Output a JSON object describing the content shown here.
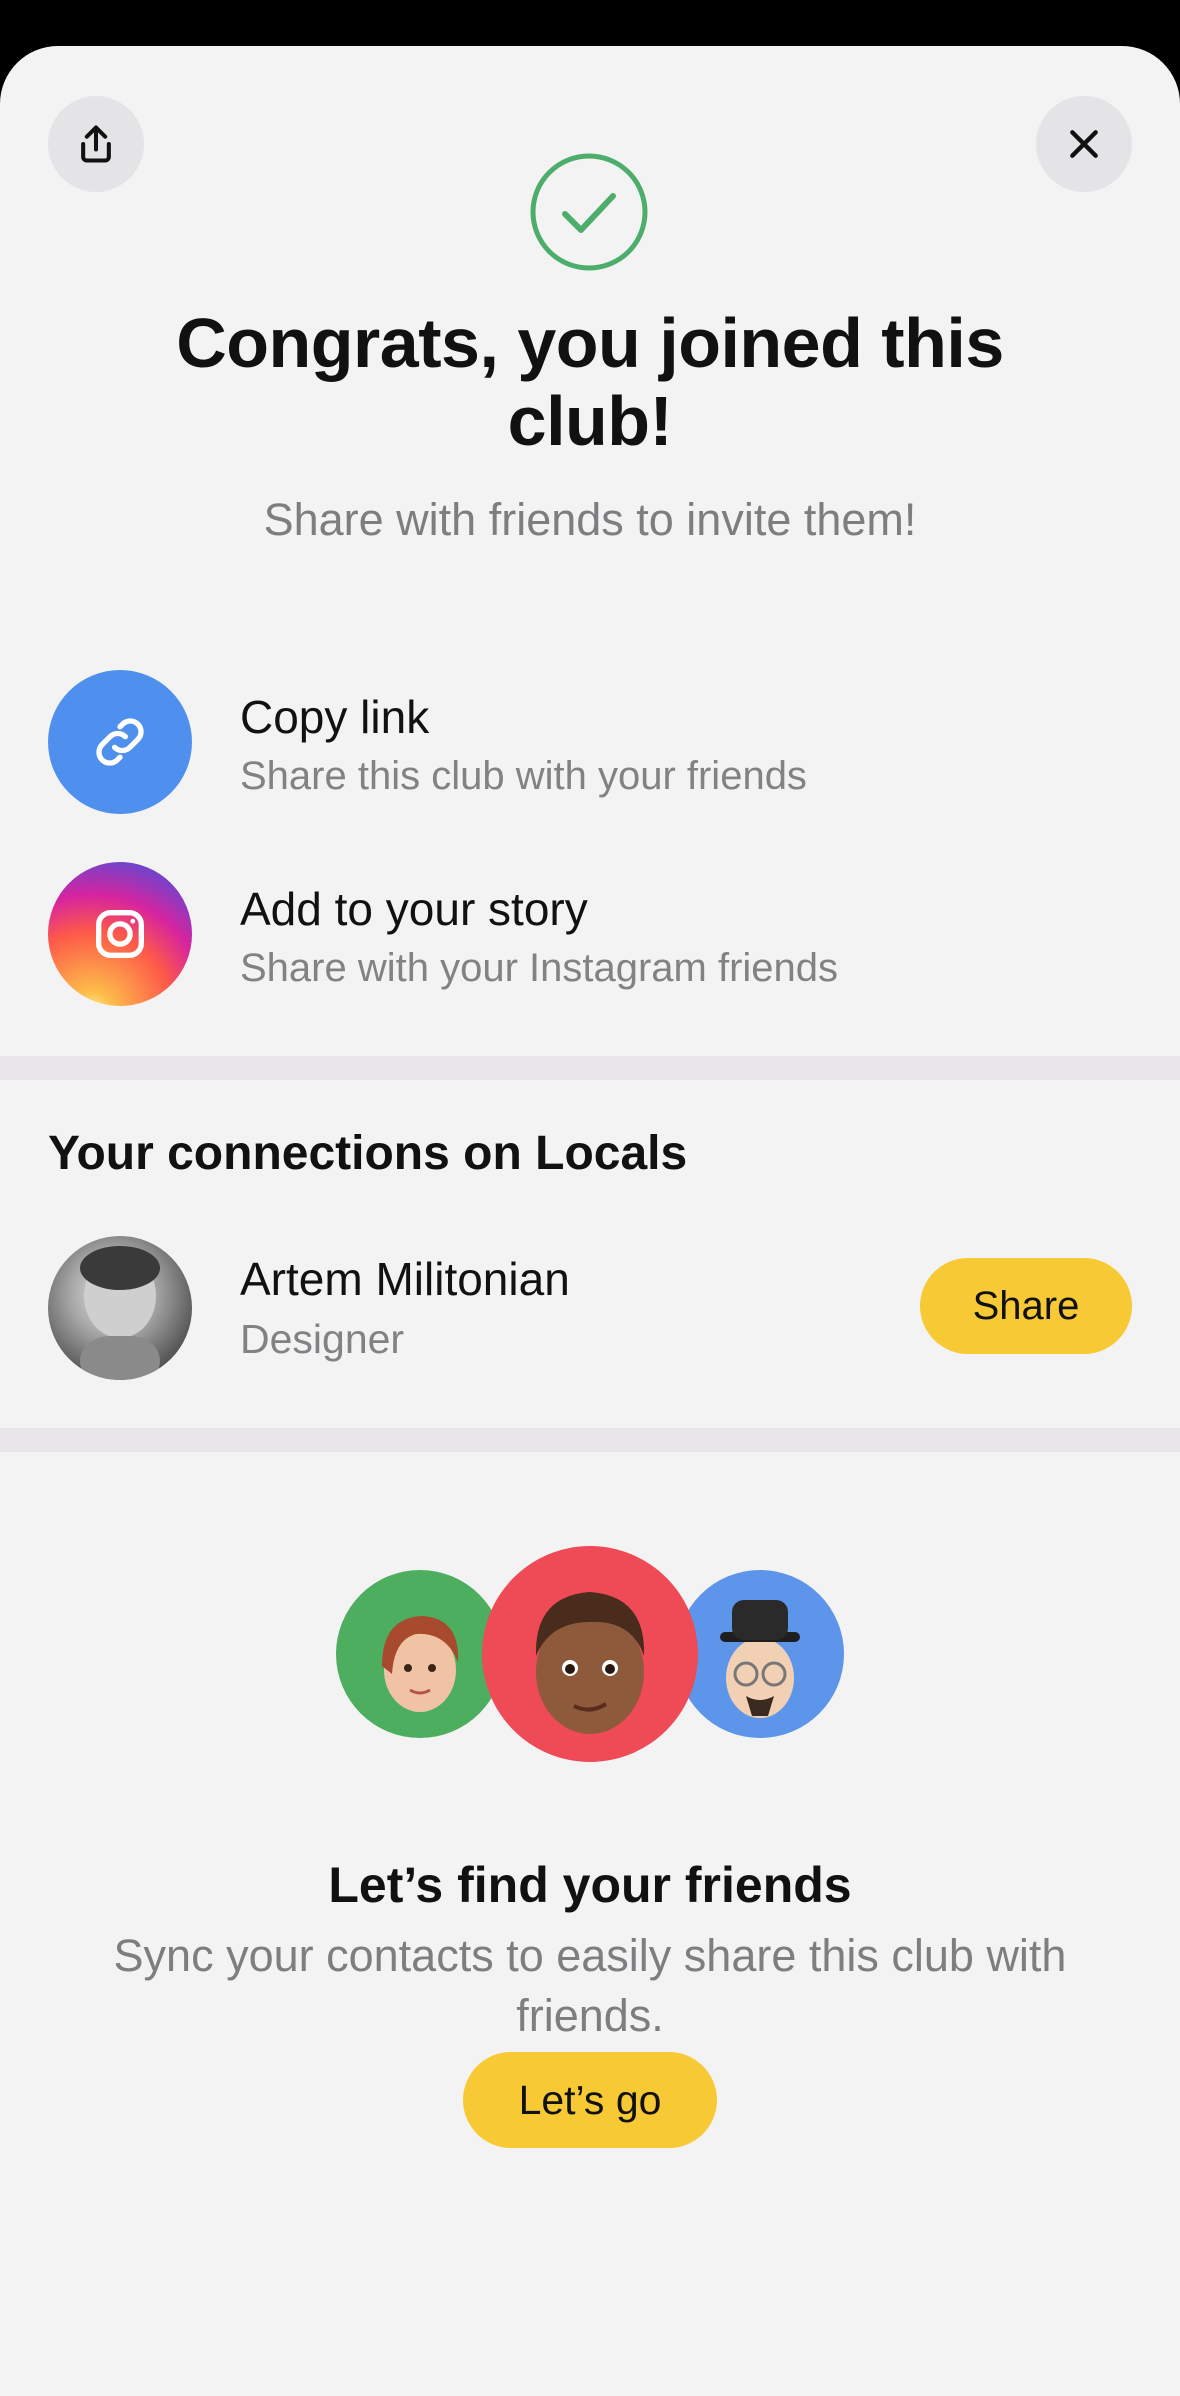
{
  "header": {
    "share_icon": "share-upload-icon",
    "close_icon": "close-icon",
    "success_icon": "checkmark-circle-icon",
    "title": "Congrats, you joined this club!",
    "subtitle": "Share with friends to invite them!"
  },
  "share_options": [
    {
      "icon": "link-icon",
      "title": "Copy link",
      "subtitle": "Share this club with your friends",
      "color": "#4f90ee"
    },
    {
      "icon": "instagram-icon",
      "title": "Add to your story",
      "subtitle": "Share with your Instagram friends",
      "color": "#e1306c"
    }
  ],
  "connections": {
    "heading": "Your connections on Locals",
    "items": [
      {
        "name": "Artem Militonian",
        "role": "Designer",
        "button": "Share"
      }
    ]
  },
  "find_friends": {
    "title": "Let’s find your friends",
    "subtitle": "Sync your contacts to easily share this club with friends.",
    "button": "Let’s go",
    "avatar_colors": [
      "#4cae5e",
      "#ee4b57",
      "#5d95ea"
    ]
  },
  "colors": {
    "accent_yellow": "#f7c935",
    "success_green": "#4cae6a",
    "background": "#f4f3f4"
  }
}
